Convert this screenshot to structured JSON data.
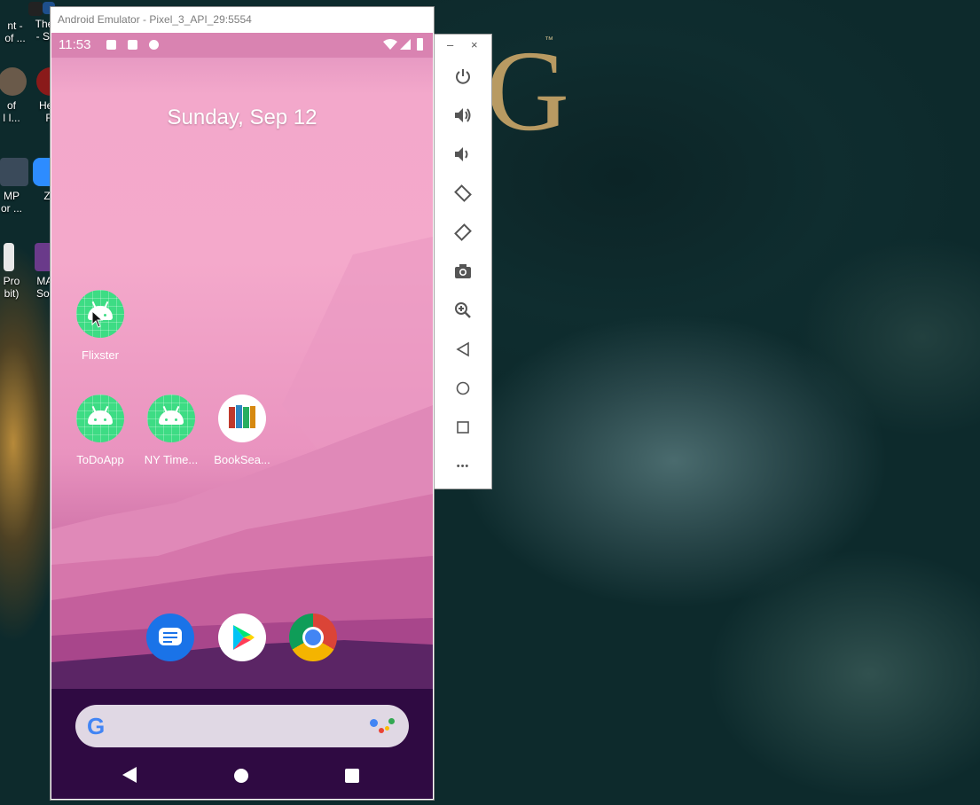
{
  "desktop": {
    "background_text": "G",
    "trademark": "™",
    "icons": [
      {
        "label": "nt -\nof ..."
      },
      {
        "label": "The L\n- Sea"
      },
      {
        "label": "of\nl I..."
      },
      {
        "label": "Hear\nFr"
      },
      {
        "label": "MP\nor ..."
      },
      {
        "label": "Z"
      },
      {
        "label": "Pro\nbit)"
      },
      {
        "label": "MAG\nSoun"
      }
    ]
  },
  "window": {
    "title": "Android Emulator - Pixel_3_API_29:5554"
  },
  "status_bar": {
    "time": "11:53"
  },
  "home": {
    "date": "Sunday, Sep 12",
    "apps": [
      {
        "label": "Flixster",
        "icon": "android-icon"
      },
      {
        "label": "ToDoApp",
        "icon": "android-icon"
      },
      {
        "label": "NY Time...",
        "icon": "android-icon"
      },
      {
        "label": "BookSea...",
        "icon": "books-icon"
      }
    ],
    "dock": [
      {
        "name": "Messages",
        "icon": "messages-icon",
        "color": "#1a73e8"
      },
      {
        "name": "Play Store",
        "icon": "play-store-icon",
        "color": "#ffffff"
      },
      {
        "name": "Chrome",
        "icon": "chrome-icon",
        "color": "#ffffff"
      }
    ],
    "search": {
      "google_letter": "G"
    }
  },
  "toolbar": {
    "minimize": "–",
    "close": "×",
    "buttons": [
      "power-icon",
      "volume-up-icon",
      "volume-down-icon",
      "rotate-left-icon",
      "rotate-right-icon",
      "camera-icon",
      "zoom-icon",
      "back-icon",
      "home-icon",
      "overview-icon",
      "more-icon"
    ],
    "more_label": "•••"
  },
  "colors": {
    "accent_android": "#3ddc84",
    "wallpaper_top": "#f4a9cb",
    "wallpaper_bottom": "#2a073d"
  }
}
